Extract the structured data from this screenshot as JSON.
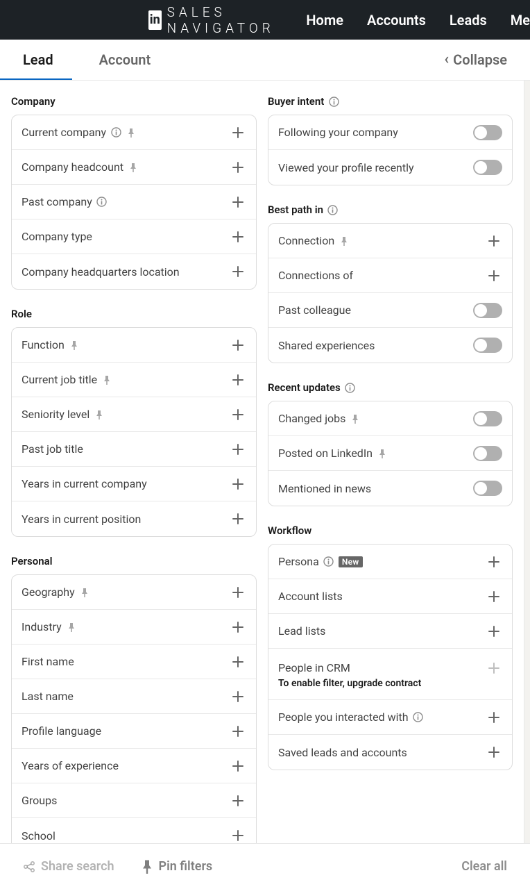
{
  "header": {
    "brand_letter": "in",
    "brand_title": "Sales Navigator",
    "nav": {
      "home": "Home",
      "accounts": "Accounts",
      "leads": "Leads",
      "me": "Me"
    }
  },
  "tabs": {
    "lead": "Lead",
    "account": "Account",
    "collapse": "Collapse"
  },
  "left": {
    "company": {
      "title": "Company",
      "items": [
        {
          "label": "Current company",
          "info": true,
          "pin": true
        },
        {
          "label": "Company headcount",
          "pin": true
        },
        {
          "label": "Past company",
          "info": true
        },
        {
          "label": "Company type"
        },
        {
          "label": "Company headquarters location"
        }
      ]
    },
    "role": {
      "title": "Role",
      "items": [
        {
          "label": "Function",
          "pin": true
        },
        {
          "label": "Current job title",
          "pin": true
        },
        {
          "label": "Seniority level",
          "pin": true
        },
        {
          "label": "Past job title"
        },
        {
          "label": "Years in current company"
        },
        {
          "label": "Years in current position"
        }
      ]
    },
    "personal": {
      "title": "Personal",
      "items": [
        {
          "label": "Geography",
          "pin": true
        },
        {
          "label": "Industry",
          "pin": true
        },
        {
          "label": "First name"
        },
        {
          "label": "Last name"
        },
        {
          "label": "Profile language"
        },
        {
          "label": "Years of experience"
        },
        {
          "label": "Groups"
        },
        {
          "label": "School"
        }
      ]
    }
  },
  "right": {
    "buyer_intent": {
      "title": "Buyer intent",
      "items": [
        {
          "label": "Following your company"
        },
        {
          "label": "Viewed your profile recently"
        }
      ]
    },
    "best_path": {
      "title": "Best path in",
      "expand": [
        {
          "label": "Connection",
          "pin": true
        },
        {
          "label": "Connections of"
        }
      ],
      "toggles": [
        {
          "label": "Past colleague"
        },
        {
          "label": "Shared experiences"
        }
      ]
    },
    "recent_updates": {
      "title": "Recent updates",
      "items": [
        {
          "label": "Changed jobs",
          "pin": true
        },
        {
          "label": "Posted on LinkedIn",
          "pin": true
        },
        {
          "label": "Mentioned in news"
        }
      ]
    },
    "workflow": {
      "title": "Workflow",
      "persona": {
        "label": "Persona",
        "badge": "New"
      },
      "account_lists": "Account lists",
      "lead_lists": "Lead lists",
      "crm": {
        "label": "People in CRM",
        "note": "To enable filter, upgrade contract"
      },
      "interacted": "People you interacted with",
      "saved": "Saved leads and accounts"
    }
  },
  "footer": {
    "share": "Share search",
    "pin": "Pin filters",
    "clear": "Clear all"
  }
}
